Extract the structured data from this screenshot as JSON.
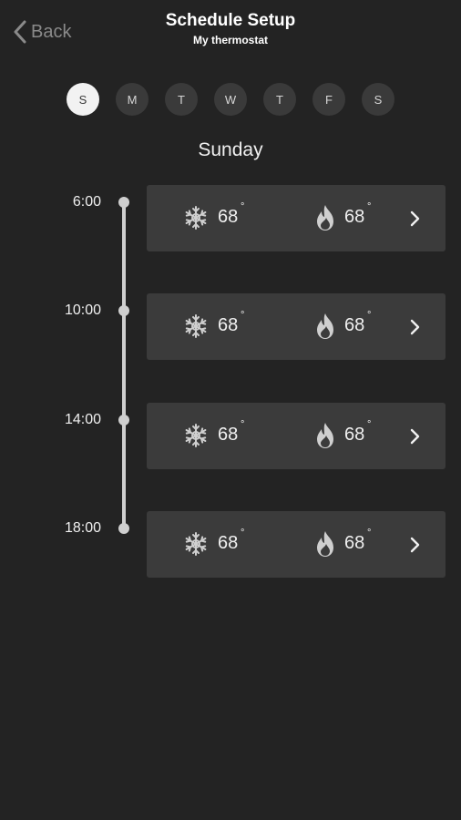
{
  "header": {
    "back_label": "Back",
    "title": "Schedule Setup",
    "subtitle": "My thermostat"
  },
  "days": [
    {
      "label": "S",
      "active": true
    },
    {
      "label": "M",
      "active": false
    },
    {
      "label": "T",
      "active": false
    },
    {
      "label": "W",
      "active": false
    },
    {
      "label": "T",
      "active": false
    },
    {
      "label": "F",
      "active": false
    },
    {
      "label": "S",
      "active": false
    }
  ],
  "selected_day": "Sunday",
  "slots": [
    {
      "time": "6:00",
      "cool": "68",
      "heat": "68",
      "degree": "°"
    },
    {
      "time": "10:00",
      "cool": "68",
      "heat": "68",
      "degree": "°"
    },
    {
      "time": "14:00",
      "cool": "68",
      "heat": "68",
      "degree": "°"
    },
    {
      "time": "18:00",
      "cool": "68",
      "heat": "68",
      "degree": "°"
    }
  ],
  "icons": {
    "back": "chevron-left-icon",
    "cool": "snowflake-icon",
    "heat": "flame-icon",
    "open": "chevron-right-icon"
  },
  "colors": {
    "background": "#232323",
    "card": "#3b3b3b",
    "day_active_bg": "#f2f2f2",
    "day_bg": "#3a3a3a"
  }
}
